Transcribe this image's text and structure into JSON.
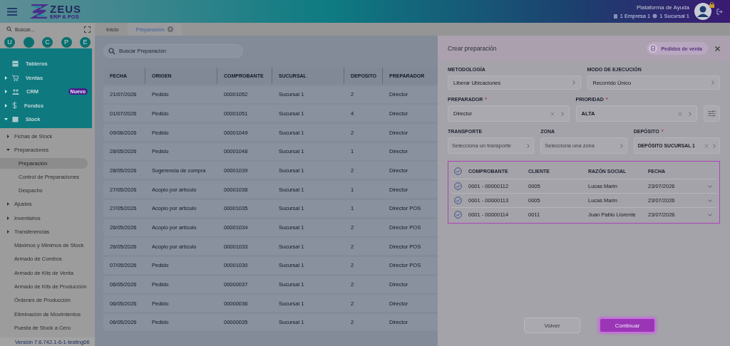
{
  "header": {
    "logo": {
      "name": "ZEUS",
      "tagline": "ERP & POS"
    },
    "help": "Plataforma de Ayuda",
    "company": "1 Empresa 1",
    "branch": "1 Sucursal 1"
  },
  "sidebar": {
    "search": {
      "placeholder": "Buscar..."
    },
    "shortcuts": [
      {
        "kind": "letter",
        "letter": "U"
      },
      {
        "kind": "blank"
      },
      {
        "kind": "letter",
        "letter": "C"
      },
      {
        "kind": "letter",
        "letter": "P"
      },
      {
        "kind": "letter",
        "letter": "E"
      }
    ],
    "modules": [
      {
        "label": "Tableros"
      },
      {
        "label": "Ventas",
        "expanded": false
      },
      {
        "label": "CRM",
        "expanded": false,
        "badge": "Nuevo"
      },
      {
        "label": "Fondos",
        "expanded": false
      },
      {
        "label": "Stock",
        "expanded": true
      }
    ],
    "items": [
      {
        "label": "Fichas de Stock",
        "expanded": false
      },
      {
        "label": "Preparaciones",
        "expanded": true,
        "children": [
          {
            "label": "Preparación",
            "selected": true
          },
          {
            "label": "Control de Preparaciones",
            "selected": false
          },
          {
            "label": "Despacho",
            "selected": false
          }
        ]
      },
      {
        "label": "Ajustes",
        "expanded": false
      },
      {
        "label": "Inventarios",
        "expanded": false
      },
      {
        "label": "Transferencias",
        "expanded": false
      },
      {
        "label": "Máximos y Mínimos de Stock"
      },
      {
        "label": "Armado de Combos"
      },
      {
        "label": "Armado de Kits de Venta"
      },
      {
        "label": "Armado de Kits de Producción"
      },
      {
        "label": "Órdenes de Producción"
      },
      {
        "label": "Eliminación de Movimientos"
      },
      {
        "label": "Puesta de Stock a Cero"
      }
    ],
    "version": "Versión 7.6.742.1-6-1-testing06"
  },
  "tabs": [
    {
      "label": "Inicio",
      "selected": false
    },
    {
      "label": "Preparación",
      "selected": true,
      "closable": true
    }
  ],
  "list": {
    "search": {
      "placeholder": "Buscar Preparación"
    },
    "columns": [
      "FECHA",
      "ORIGEN",
      "COMPROBANTE",
      "SUCURSAL",
      "DEPOSITO",
      "PREPARADOR"
    ],
    "rows": [
      [
        "21/07/2026",
        "Pedido",
        "00001052",
        "Sucursal 1",
        "2",
        "Director"
      ],
      [
        "01/07/2026",
        "Pedido",
        "00001051",
        "Sucursal 1",
        "4",
        "Director"
      ],
      [
        "09/06/2026",
        "Pedido",
        "00001049",
        "Sucursal 1",
        "2",
        "Director"
      ],
      [
        "28/05/2026",
        "Pedido",
        "00001048",
        "Sucursal 1",
        "1",
        "Director"
      ],
      [
        "28/05/2026",
        "Sugerencia de compra",
        "00001039",
        "Sucursal 1",
        "2",
        "Director"
      ],
      [
        "27/05/2026",
        "Acopio por artículo",
        "00001038",
        "Sucursal 1",
        "1",
        "Director"
      ],
      [
        "27/05/2026",
        "Acopio por artículo",
        "00001035",
        "Sucursal 1",
        "1",
        "Director POS"
      ],
      [
        "26/05/2026",
        "Acopio por artículo",
        "00001034",
        "Sucursal 1",
        "2",
        "Director POS"
      ],
      [
        "26/05/2026",
        "Acopio por artículo",
        "00001033",
        "Sucursal 1",
        "2",
        "Director POS"
      ],
      [
        "07/05/2026",
        "Pedido",
        "00001030",
        "Sucursal 1",
        "2",
        "Director POS"
      ],
      [
        "06/05/2026",
        "Pedido",
        "00000037",
        "Sucursal 1",
        "2",
        "Director"
      ],
      [
        "06/05/2026",
        "Pedido",
        "00000036",
        "Sucursal 1",
        "2",
        "Director"
      ],
      [
        "06/05/2026",
        "Pedido",
        "00000035",
        "Sucursal 1",
        "2",
        "Director"
      ]
    ]
  },
  "drawer": {
    "title": "Crear preparación",
    "source_button": "Pedidos de venta",
    "field_rows": [
      [
        {
          "label": "METODOLOGÍA",
          "value": "Liberar Ubicaciones"
        },
        {
          "label": "MODO DE EJECUCIÓN",
          "value": "Recorrido Único"
        }
      ],
      [
        {
          "label": "PREPARADOR",
          "required_mark": "*",
          "value": "Director",
          "clearable": true
        },
        {
          "label": "PRIORIDAD",
          "required_mark": "*",
          "value": "ALTA",
          "clearable": true,
          "bold": true
        }
      ],
      [
        {
          "label": "TRANSPORTE",
          "placeholder": "Selecciona un transporte"
        },
        {
          "label": "ZONA",
          "placeholder": "Selecciona una zona"
        },
        {
          "label": "DEPÓSITO",
          "required_mark": "*",
          "value": "DEPÓSITO SUCURSAL 1",
          "clearable": true,
          "bold": true
        }
      ]
    ],
    "table": {
      "all_checked": true,
      "columns": [
        "COMPROBANTE",
        "CLIENTE",
        "RAZÓN SOCIAL",
        "FECHA"
      ],
      "rows": [
        {
          "checked": true,
          "cells": [
            "0001 - 00000112",
            "0005",
            "Lucas Marin",
            "23/07/2026"
          ]
        },
        {
          "checked": true,
          "cells": [
            "0001 - 00000113",
            "0005",
            "Lucas Marin",
            "23/07/2026"
          ]
        },
        {
          "checked": true,
          "cells": [
            "0001 - 00000114",
            "0011",
            "Juan Pablo Llorente",
            "23/07/2026"
          ]
        }
      ]
    },
    "buttons": {
      "back": "Volver",
      "next": "Continuar"
    }
  }
}
